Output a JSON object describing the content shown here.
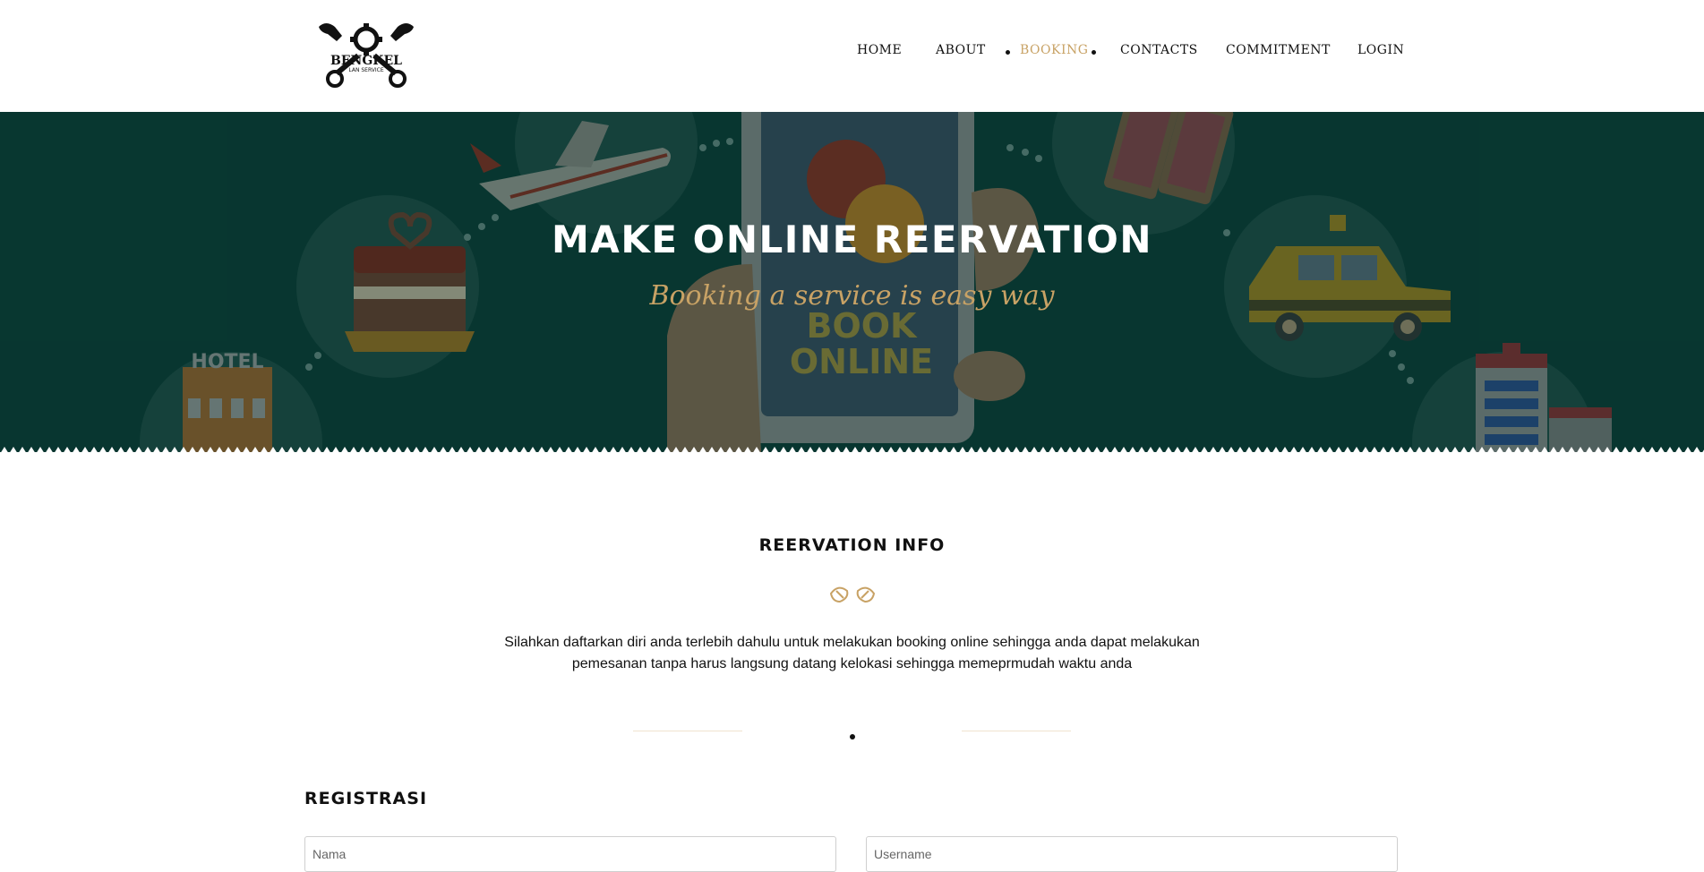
{
  "brand": {
    "logo_text": "BENGKEL",
    "logo_subtext": "LAN SERVICE"
  },
  "nav": {
    "items": [
      {
        "label": "HOME"
      },
      {
        "label": "ABOUT"
      },
      {
        "label": "BOOKING"
      },
      {
        "label": "CONTACTS"
      },
      {
        "label": "COMMITMENT"
      },
      {
        "label": "LOGIN"
      }
    ],
    "active": "BOOKING"
  },
  "hero": {
    "title": "MAKE ONLINE REERVATION",
    "subtitle": "Booking a service is easy way",
    "illustration": {
      "sign_text": "HOTEL",
      "phone_text_line1": "BOOK",
      "phone_text_line2": "ONLINE"
    }
  },
  "info": {
    "title": "REERVATION INFO",
    "description": "Silahkan daftarkan diri anda terlebih dahulu untuk melakukan booking online sehingga anda dapat melakukan pemesanan tanpa harus langsung datang kelokasi sehingga memeprmudah waktu anda"
  },
  "registration": {
    "title": "REGISTRASI",
    "name_placeholder": "Nama",
    "username_placeholder": "Username"
  },
  "colors": {
    "accent": "#c8a265",
    "hero_bg": "#0b3a33",
    "text": "#111111"
  },
  "icons": [
    "wrench-gear-logo-icon",
    "leaf-ornament-icon"
  ]
}
